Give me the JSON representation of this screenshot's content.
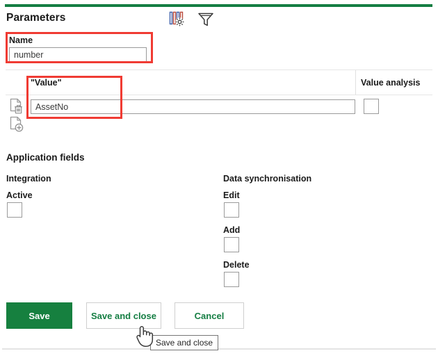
{
  "theme": {
    "accent_green": "#157e43",
    "button_green": "#16803f",
    "highlight_red": "#f03b33",
    "border_gray": "#9a9a9a"
  },
  "header": {
    "title": "Parameters",
    "icons": [
      {
        "name": "column-settings-icon",
        "label": "Column settings"
      },
      {
        "name": "filter-icon",
        "label": "Filter"
      }
    ]
  },
  "name_field": {
    "label": "Name",
    "value": "number",
    "placeholder": ""
  },
  "grid": {
    "columns": [
      {
        "name": "value",
        "label": "\"Value\""
      },
      {
        "name": "value-analysis",
        "label": "Value analysis"
      }
    ],
    "rows": [
      {
        "value": "AssetNo",
        "value_placeholder": "",
        "value_analysis_checked": false,
        "row_actions": [
          {
            "name": "delete-row-icon",
            "label": "Delete"
          },
          {
            "name": "add-row-icon",
            "label": "Add"
          }
        ]
      }
    ]
  },
  "application_fields": {
    "title": "Application fields",
    "integration": {
      "title": "Integration",
      "fields": [
        {
          "label": "Active",
          "checked": false
        }
      ]
    },
    "data_synchronisation": {
      "title": "Data synchronisation",
      "fields": [
        {
          "label": "Edit",
          "checked": false
        },
        {
          "label": "Add",
          "checked": false
        },
        {
          "label": "Delete",
          "checked": false
        }
      ]
    }
  },
  "actions": {
    "save": "Save",
    "save_and_close": "Save and close",
    "cancel": "Cancel"
  },
  "tooltip": {
    "text": "Save and close"
  }
}
